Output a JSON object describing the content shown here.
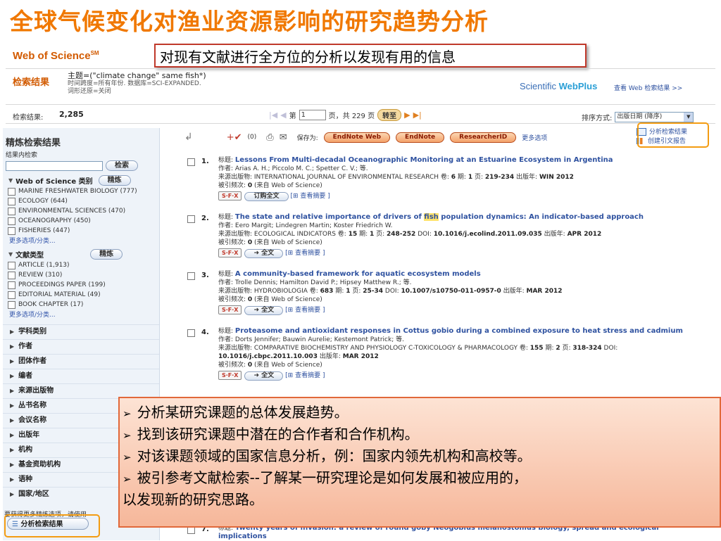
{
  "slide": {
    "title": "全球气候变化对渔业资源影响的研究趋势分析",
    "callout": "对现有文献进行全方位的分析以发现有用的信息"
  },
  "header": {
    "logo": "Web of Science",
    "logo_sup": "SM",
    "results_label": "检索结果",
    "query_line": "主题=(\"climate change\" same fish*)",
    "query_sub1": "时间跨度=所有年份. 数据库=SCI-EXPANDED.",
    "query_sub2": "词形还原=关闭",
    "webplus_prefix": "Scientific ",
    "webplus_brand": "WebPlus",
    "webplus_link": "查看 Web 检索结果 >>"
  },
  "pager": {
    "results_label": "检索结果:",
    "results_count": "2,285",
    "page_prefix": "第",
    "page_value": "1",
    "page_suffix": "页，共 229 页",
    "go_label": "转至",
    "sort_label": "排序方式:",
    "sort_value": "出版日期 (降序)"
  },
  "sidebar": {
    "title": "精炼检索结果",
    "search_label": "结果内检索",
    "search_button": "检索",
    "refine_button": "精炼",
    "cat1_title": "Web of Science 类别",
    "cat1_items": [
      "MARINE FRESHWATER BIOLOGY (777)",
      "ECOLOGY (644)",
      "ENVIRONMENTAL SCIENCES (470)",
      "OCEANOGRAPHY (450)",
      "FISHERIES (447)"
    ],
    "more_label": "更多选项/分类...",
    "cat2_title": "文献类型",
    "cat2_items": [
      "ARTICLE (1,913)",
      "REVIEW (310)",
      "PROCEEDINGS PAPER (199)",
      "EDITORIAL MATERIAL (49)",
      "BOOK CHAPTER (17)"
    ],
    "facets": [
      "学科类别",
      "作者",
      "团体作者",
      "编者",
      "来源出版物",
      "丛书名称",
      "会议名称",
      "出版年",
      "机构",
      "基金资助机构",
      "语种",
      "国家/地区"
    ],
    "bottom_note": "要获得更多精炼选项，请使用",
    "analyze_button": "分析检索结果"
  },
  "toolbar": {
    "marked": "(0)",
    "save_label": "保存为:",
    "endnote_web": "EndNote Web",
    "endnote": "EndNote",
    "researcherid": "ResearcherID",
    "more": "更多选项",
    "analyze_link": "分析检索结果",
    "citation_report": "创建引文报告"
  },
  "records": [
    {
      "num": "1.",
      "title_label": "标题:",
      "title": "Lessons From Multi-decadal Oceanographic Monitoring at an Estuarine Ecosystem in Argentina",
      "authors": "作者: Arias A. H.; Piccolo M. C.; Spetter C. V.; 等.",
      "source_prefix": "来源出版物: INTERNATIONAL JOURNAL OF ENVIRONMENTAL RESEARCH  卷: ",
      "vol": "6",
      "issue_label": "  期: ",
      "issue": "1",
      "pages_label": "  页: ",
      "pages": "219-234",
      "extra": "",
      "date_label": "  出版年: ",
      "date": "WIN 2012",
      "cited_label": "被引频次: ",
      "cited": "0",
      "cited_suffix": " (来自 Web of Science)",
      "sfx": "S·F·X",
      "fulltext": "订购全文",
      "abstract": "[⊞ 查看摘要 ]"
    },
    {
      "num": "2.",
      "title_label": "标题:",
      "title_a": "The state and relative importance of drivers of ",
      "title_hl": "fish",
      "title_b": " population dynamics: An indicator-based approach",
      "authors": "作者: Eero Margit; Lindegren Martin; Koster Friedrich W.",
      "source_prefix": "来源出版物: ECOLOGICAL INDICATORS  卷: ",
      "vol": "15",
      "issue_label": "  期: ",
      "issue": "1",
      "pages_label": "  页: ",
      "pages": "248-252",
      "doi_label": "  DOI: ",
      "doi": "10.1016/j.ecolind.2011.09.035",
      "date_label": "  出版年: ",
      "date": "APR 2012",
      "cited_label": "被引频次: ",
      "cited": "0",
      "cited_suffix": " (来自 Web of Science)",
      "sfx": "S·F·X",
      "fulltext": "➜ 全文",
      "abstract": "[⊞ 查看摘要 ]"
    },
    {
      "num": "3.",
      "title_label": "标题:",
      "title": "A community-based framework for aquatic ecosystem models",
      "authors": "作者: Trolle Dennis; Hamilton David P.; Hipsey Matthew R.; 等.",
      "source_prefix": "来源出版物: HYDROBIOLOGIA  卷: ",
      "vol": "683",
      "issue_label": "  期: ",
      "issue": "1",
      "pages_label": "  页: ",
      "pages": "25-34",
      "doi_label": "  DOI: ",
      "doi": "10.1007/s10750-011-0957-0",
      "date_label": "  出版年: ",
      "date": "MAR 2012",
      "cited_label": "被引频次: ",
      "cited": "0",
      "cited_suffix": " (来自 Web of Science)",
      "sfx": "S·F·X",
      "fulltext": "➜ 全文",
      "abstract": "[⊞ 查看摘要 ]"
    },
    {
      "num": "4.",
      "title_label": "标题:",
      "title": "Proteasome and antioxidant responses in Cottus gobio during a combined exposure to heat stress and cadmium",
      "authors": "作者: Dorts Jennifer; Bauwin Aurelie; Kestemont Patrick; 等.",
      "source_prefix": "来源出版物: COMPARATIVE BIOCHEMISTRY AND PHYSIOLOGY C-TOXICOLOGY & PHARMACOLOGY  卷: ",
      "vol": "155",
      "issue_label": "  期: ",
      "issue": "2",
      "pages_label": "  页: ",
      "pages": "318-324",
      "doi_label": "  DOI: ",
      "doi": "10.1016/j.cbpc.2011.10.003",
      "date_label": "  出版年: ",
      "date": "MAR 2012",
      "cited_label": "被引频次: ",
      "cited": "0",
      "cited_suffix": " (来自 Web of Science)",
      "sfx": "S·F·X",
      "fulltext": "➜ 全文",
      "abstract": "[⊞ 查看摘要 ]"
    },
    {
      "num": "7.",
      "title_label": "标题:",
      "title": "Twenty years of invasion: a review of round goby Neogobius melanostomus biology, spread and ecological implications"
    }
  ],
  "overlay": {
    "bullets": [
      "分析某研究课题的总体发展趋势。",
      "找到该研究课题中潜在的合作者和合作机构。",
      "对该课题领域的国家信息分析，例：国家内领先机构和高校等。",
      "被引参考文献检索--了解某一研究理论是如何发展和被应用的，"
    ],
    "continuation": "以发现新的研究思路。"
  },
  "colors": {
    "title": "#f07800",
    "link": "#2f52a0",
    "overlay_border": "#e1683a",
    "highlight_box": "#f39c12"
  }
}
